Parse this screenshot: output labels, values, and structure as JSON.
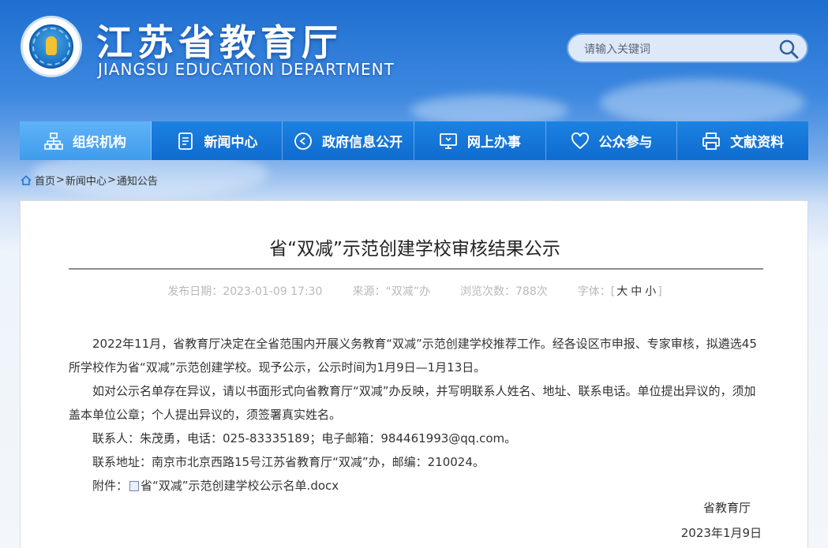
{
  "site": {
    "title_cn": "江苏省教育厅",
    "title_en": "JIANGSU EDUCATION DEPARTMENT"
  },
  "search": {
    "placeholder": "请输入关键词",
    "icon": "search-icon"
  },
  "nav": {
    "items": [
      {
        "label": "组织机构",
        "icon": "org-chart-icon",
        "active": true
      },
      {
        "label": "新闻中心",
        "icon": "document-icon",
        "active": false
      },
      {
        "label": "政府信息公开",
        "icon": "play-circle-icon",
        "active": false
      },
      {
        "label": "网上办事",
        "icon": "monitor-icon",
        "active": false
      },
      {
        "label": "公众参与",
        "icon": "heart-icon",
        "active": false
      },
      {
        "label": "文献资料",
        "icon": "printer-icon",
        "active": false
      }
    ]
  },
  "breadcrumb": {
    "home": "首页",
    "items": [
      "新闻中心",
      "通知公告"
    ],
    "separator": ">"
  },
  "article": {
    "title": "省“双减”示范创建学校审核结果公示",
    "publish_date": "发布日期：2023-01-09 17:30",
    "source": "来源：“双减”办",
    "views": "浏览次数：788次",
    "font_label": "字体：",
    "font_open": "[",
    "font_close": "]",
    "font_large": "大",
    "font_medium": "中",
    "font_small": "小",
    "paragraphs": [
      "2022年11月，省教育厅决定在全省范围内开展义务教育“双减”示范创建学校推荐工作。经各设区市申报、专家审核，拟遴选45所学校作为省“双减”示范创建学校。现予公示，公示时间为1月9日—1月13日。",
      "如对公示名单存在异议，请以书面形式向省教育厅“双减”办反映，并写明联系人姓名、地址、联系电话。单位提出异议的，须加盖本单位公章；个人提出异议的，须签署真实姓名。"
    ],
    "contact": "联系人：朱茂勇，电话：025-83335189；电子邮箱：984461993@qq.com。",
    "address": "联系地址：南京市北京西路15号江苏省教育厅“双减”办，邮编：210024。",
    "attachment_label": "附件：",
    "attachment_file": "省“双减”示范创建学校公示名单.docx",
    "signature": "省教育厅",
    "sign_date": "2023年1月9日"
  },
  "colors": {
    "nav_bg": "#0f6bcf",
    "nav_active": "#3f9cec",
    "text": "#333333",
    "meta_text": "#b9b9b9"
  }
}
